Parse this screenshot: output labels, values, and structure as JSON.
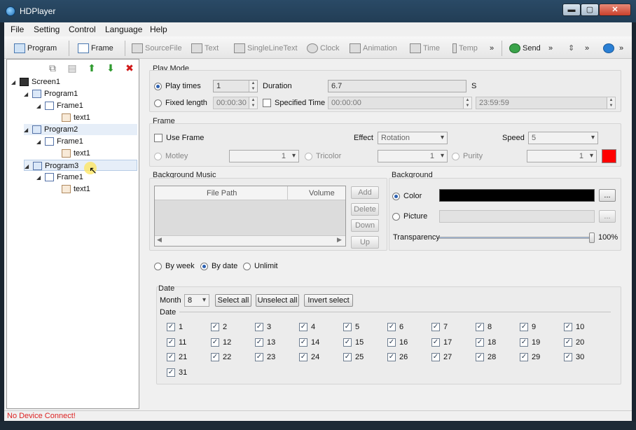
{
  "window": {
    "title": "HDPlayer",
    "min": "▬",
    "max": "▢",
    "close": "✕"
  },
  "menu": [
    "File",
    "Setting",
    "Control",
    "Language",
    "Help"
  ],
  "toolbar": {
    "program": "Program",
    "frame": "Frame",
    "sourcefile": "SourceFile",
    "text": "Text",
    "singleline": "SingleLineText",
    "clock": "Clock",
    "animation": "Animation",
    "time": "Time",
    "temp": "Temp",
    "send": "Send",
    "more": "»"
  },
  "tree": {
    "screen": "Screen1",
    "programs": [
      {
        "name": "Program1",
        "frame": "Frame1",
        "item": "text1"
      },
      {
        "name": "Program2",
        "frame": "Frame1",
        "item": "text1"
      },
      {
        "name": "Program3",
        "frame": "Frame1",
        "item": "text1"
      }
    ],
    "arrow_up": "⬆",
    "arrow_down": "⬇",
    "delete": "✖"
  },
  "play_mode": {
    "title": "Play Mode",
    "play_times_label": "Play times",
    "play_times_value": "1",
    "duration_label": "Duration",
    "duration_value": "6.7",
    "duration_unit": "S",
    "fixed_length_label": "Fixed length",
    "fixed_length_value": "00:00:30",
    "specified_time_label": "Specified Time",
    "start_time": "00:00:00",
    "end_time": "23:59:59"
  },
  "frame": {
    "title": "Frame",
    "use_frame": "Use Frame",
    "effect_label": "Effect",
    "effect_value": "Rotation",
    "speed_label": "Speed",
    "speed_value": "5",
    "motley": "Motley",
    "motley_value": "1",
    "tricolor": "Tricolor",
    "tricolor_value": "1",
    "purity": "Purity",
    "purity_value": "1",
    "color_swatch": "#ff0000"
  },
  "bg_music": {
    "title": "Background Music",
    "col_path": "File Path",
    "col_volume": "Volume",
    "add": "Add",
    "delete": "Delete",
    "down": "Down",
    "up": "Up"
  },
  "background": {
    "title": "Background",
    "color_label": "Color",
    "picture_label": "Picture",
    "browse": "...",
    "transparency_label": "Transparency",
    "transparency_value": "100%",
    "color_value": "#000000"
  },
  "schedule": {
    "by_week": "By week",
    "by_date": "By date",
    "unlimit": "Unlimit"
  },
  "date": {
    "title": "Date",
    "month_label": "Month",
    "month_value": "8",
    "select_all": "Select all",
    "unselect_all": "Unselect all",
    "invert_select": "Invert select",
    "days_label": "Date",
    "days": [
      "1",
      "2",
      "3",
      "4",
      "5",
      "6",
      "7",
      "8",
      "9",
      "10",
      "11",
      "12",
      "13",
      "14",
      "15",
      "16",
      "17",
      "18",
      "19",
      "20",
      "21",
      "22",
      "23",
      "24",
      "25",
      "26",
      "27",
      "28",
      "29",
      "30",
      "31"
    ]
  },
  "status": "No Device Connect!"
}
